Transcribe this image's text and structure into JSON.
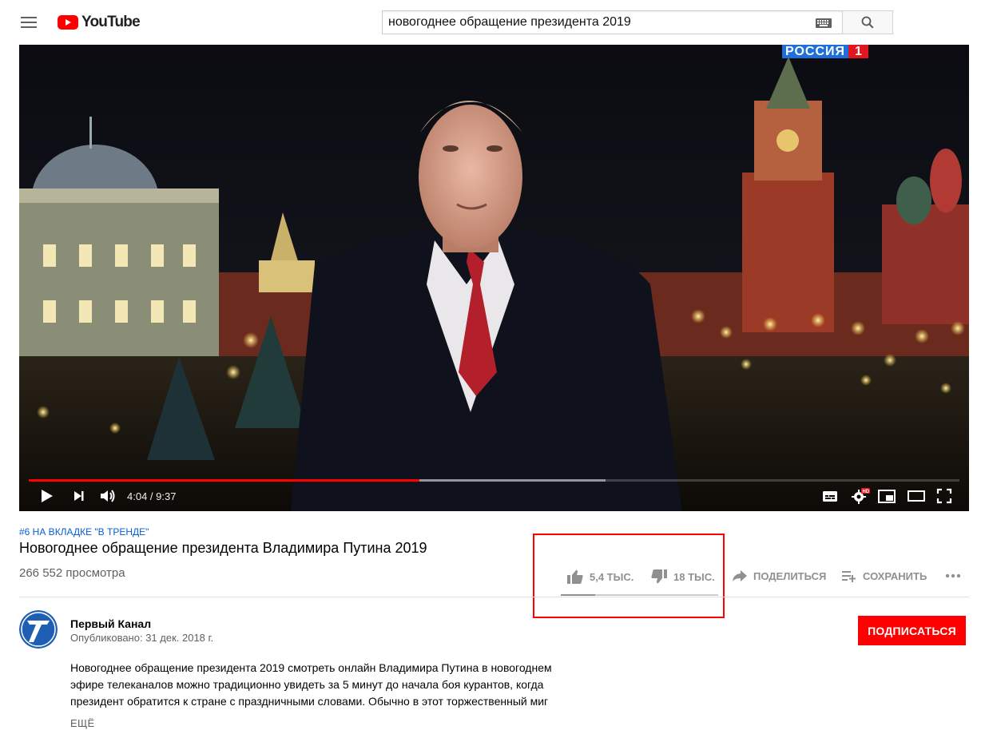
{
  "header": {
    "logo_text": "YouTube",
    "search": {
      "value": "новогоднее обращение президента 2019"
    }
  },
  "player": {
    "time_display": "4:04 / 9:37",
    "played_fraction": 0.42,
    "buffered_fraction": 0.62,
    "channel_bug": {
      "text": "РОССИЯ",
      "number": "1"
    }
  },
  "video": {
    "trending_badge": "#6 НА ВКЛАДКЕ \"В ТРЕНДЕ\"",
    "title": "Новогоднее обращение президента Владимира Путина 2019",
    "views": "266 552 просмотра"
  },
  "actions": {
    "likes": "5,4 ТЫС.",
    "dislikes": "18 ТЫС.",
    "share_label": "ПОДЕЛИТЬСЯ",
    "save_label": "СОХРАНИТЬ",
    "like_fraction": 0.22
  },
  "channel": {
    "name": "Первый Канал",
    "published": "Опубликовано: 31 дек. 2018 г.",
    "subscribe_label": "ПОДПИСАТЬСЯ"
  },
  "description": {
    "lines": [
      "Новогоднее обращение президента 2019 смотреть онлайн Владимира Путина в новогоднем",
      "эфире телеканалов можно традиционно увидеть за 5 минут до начала боя курантов, когда",
      "президент обратится к стране с праздничными словами. Обычно в этот торжественный миг"
    ],
    "more_label": "ЕЩЁ"
  },
  "colors": {
    "accent": "#ff0000",
    "link": "#065fd4",
    "muted": "#606060"
  }
}
